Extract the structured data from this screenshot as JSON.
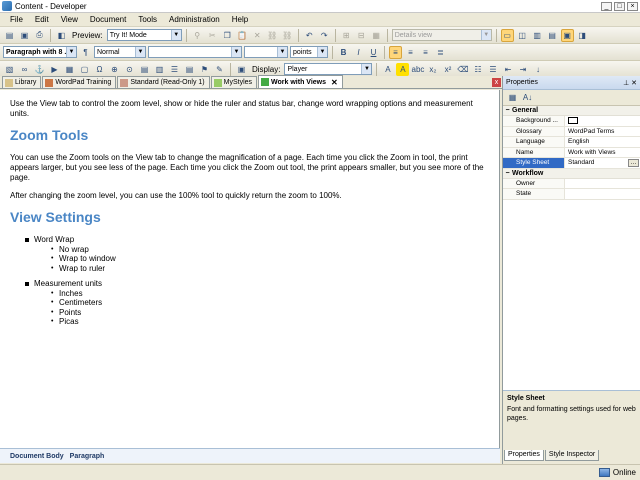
{
  "window": {
    "title": "Content - Developer"
  },
  "menu": [
    "File",
    "Edit",
    "View",
    "Document",
    "Tools",
    "Administration",
    "Help"
  ],
  "toolbar1": {
    "preview_label": "Preview:",
    "preview_value": "Try It! Mode",
    "view_mode": "Details view"
  },
  "toolbar2": {
    "paragraph_style": "Paragraph with 8 ...",
    "font_style": "Normal",
    "font_name": "",
    "font_size": "",
    "size_unit": "points"
  },
  "toolbar3": {
    "display_label": "Display:",
    "display_value": "Player"
  },
  "tabs": [
    {
      "label": "Library",
      "icon": "library-icon"
    },
    {
      "label": "WordPad Training",
      "icon": "document-icon"
    },
    {
      "label": "Standard (Read-Only 1)",
      "icon": "document-icon"
    },
    {
      "label": "MyStyles",
      "icon": "stylesheet-icon"
    },
    {
      "label": "Work with Views",
      "icon": "checked-document-icon"
    }
  ],
  "document": {
    "intro": "Use the View tab to control the zoom level, show or hide the ruler and status bar, change word wrapping options and measurement units.",
    "h_zoom": "Zoom Tools",
    "zoom_p1": "You can use the Zoom tools on the View tab to change the magnification of a page. Each time you click the Zoom in tool, the print appears larger, but you see less of the page. Each time you click the Zoom out tool, the print appears smaller, but you see more of the page.",
    "zoom_p2": "After changing the zoom level, you can use the 100% tool to quickly return the zoom to 100%.",
    "h_view": "View Settings",
    "settings": [
      {
        "label": "Word Wrap",
        "items": [
          "No wrap",
          "Wrap to window",
          "Wrap to ruler"
        ]
      },
      {
        "label": "Measurement units",
        "items": [
          "Inches",
          "Centimeters",
          "Points",
          "Picas"
        ]
      }
    ]
  },
  "status_strip": [
    "Document Body",
    "Paragraph"
  ],
  "properties": {
    "title": "Properties",
    "categories": [
      {
        "name": "General",
        "rows": [
          {
            "name": "Background ...",
            "value": ""
          },
          {
            "name": "Glossary",
            "value": "WordPad Terms"
          },
          {
            "name": "Language",
            "value": "English"
          },
          {
            "name": "Name",
            "value": "Work with Views"
          },
          {
            "name": "Style Sheet",
            "value": "Standard"
          }
        ]
      },
      {
        "name": "Workflow",
        "rows": [
          {
            "name": "Owner",
            "value": ""
          },
          {
            "name": "State",
            "value": ""
          }
        ]
      }
    ],
    "desc_title": "Style Sheet",
    "desc_text": "Font and formatting settings used for web pages.",
    "tabs": [
      "Properties",
      "Style Inspector"
    ]
  },
  "app_status": {
    "text": "Online"
  }
}
